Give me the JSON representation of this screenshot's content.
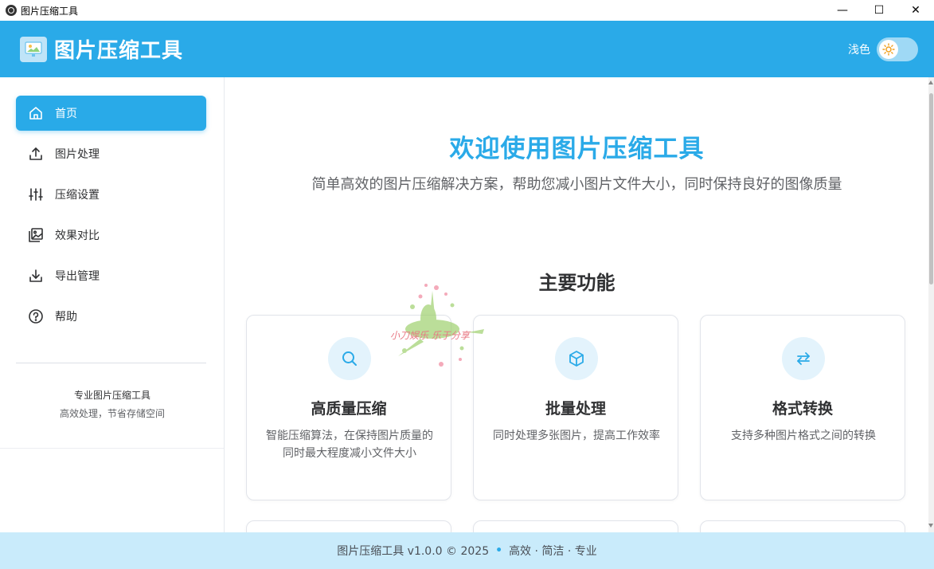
{
  "window": {
    "title": "图片压缩工具",
    "minimize_glyph": "—",
    "maximize_glyph": "☐",
    "close_glyph": "✕"
  },
  "header": {
    "app_title": "图片压缩工具",
    "theme_label": "浅色",
    "brand_color": "#2aaae8"
  },
  "sidebar": {
    "items": [
      {
        "label": "首页",
        "icon": "home-icon",
        "active": true
      },
      {
        "label": "图片处理",
        "icon": "upload-icon",
        "active": false
      },
      {
        "label": "压缩设置",
        "icon": "sliders-icon",
        "active": false
      },
      {
        "label": "效果对比",
        "icon": "image-compare-icon",
        "active": false
      },
      {
        "label": "导出管理",
        "icon": "download-icon",
        "active": false
      },
      {
        "label": "帮助",
        "icon": "help-icon",
        "active": false
      }
    ],
    "footer_title": "专业图片压缩工具",
    "footer_subtitle": "高效处理，节省存储空间"
  },
  "main": {
    "welcome": "欢迎使用图片压缩工具",
    "subtitle": "简单高效的图片压缩解决方案，帮助您减小图片文件大小，同时保持良好的图像质量",
    "section_title": "主要功能",
    "features": [
      {
        "title": "高质量压缩",
        "desc": "智能压缩算法，在保持图片质量的同时最大程度减小文件大小",
        "icon": "search-icon"
      },
      {
        "title": "批量处理",
        "desc": "同时处理多张图片，提高工作效率",
        "icon": "cube-icon"
      },
      {
        "title": "格式转换",
        "desc": "支持多种图片格式之间的转换",
        "icon": "swap-arrows-icon"
      }
    ]
  },
  "watermark": {
    "text": "小刀娱乐 乐于分享"
  },
  "footer": {
    "left": "图片压缩工具 v1.0.0 © 2025",
    "separator": "•",
    "right": "高效 · 简洁 · 专业"
  }
}
